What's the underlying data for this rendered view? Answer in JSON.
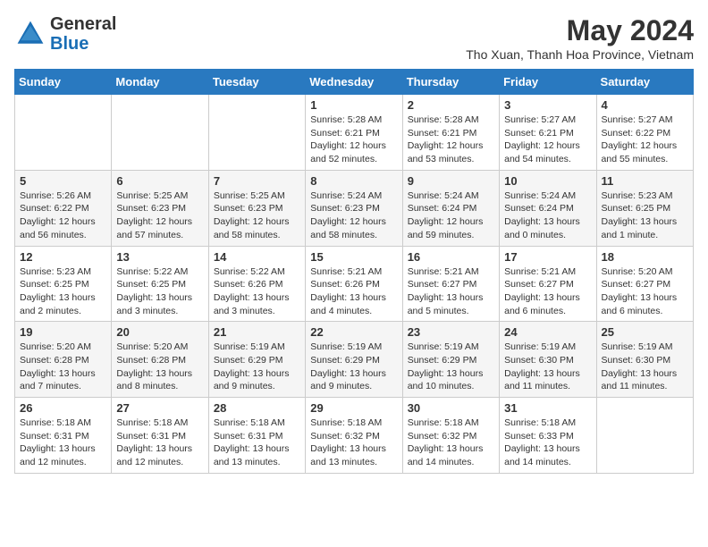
{
  "logo": {
    "general": "General",
    "blue": "Blue"
  },
  "header": {
    "month_year": "May 2024",
    "location": "Tho Xuan, Thanh Hoa Province, Vietnam"
  },
  "days_of_week": [
    "Sunday",
    "Monday",
    "Tuesday",
    "Wednesday",
    "Thursday",
    "Friday",
    "Saturday"
  ],
  "weeks": [
    [
      {
        "day": "",
        "info": ""
      },
      {
        "day": "",
        "info": ""
      },
      {
        "day": "",
        "info": ""
      },
      {
        "day": "1",
        "info": "Sunrise: 5:28 AM\nSunset: 6:21 PM\nDaylight: 12 hours\nand 52 minutes."
      },
      {
        "day": "2",
        "info": "Sunrise: 5:28 AM\nSunset: 6:21 PM\nDaylight: 12 hours\nand 53 minutes."
      },
      {
        "day": "3",
        "info": "Sunrise: 5:27 AM\nSunset: 6:21 PM\nDaylight: 12 hours\nand 54 minutes."
      },
      {
        "day": "4",
        "info": "Sunrise: 5:27 AM\nSunset: 6:22 PM\nDaylight: 12 hours\nand 55 minutes."
      }
    ],
    [
      {
        "day": "5",
        "info": "Sunrise: 5:26 AM\nSunset: 6:22 PM\nDaylight: 12 hours\nand 56 minutes."
      },
      {
        "day": "6",
        "info": "Sunrise: 5:25 AM\nSunset: 6:23 PM\nDaylight: 12 hours\nand 57 minutes."
      },
      {
        "day": "7",
        "info": "Sunrise: 5:25 AM\nSunset: 6:23 PM\nDaylight: 12 hours\nand 58 minutes."
      },
      {
        "day": "8",
        "info": "Sunrise: 5:24 AM\nSunset: 6:23 PM\nDaylight: 12 hours\nand 58 minutes."
      },
      {
        "day": "9",
        "info": "Sunrise: 5:24 AM\nSunset: 6:24 PM\nDaylight: 12 hours\nand 59 minutes."
      },
      {
        "day": "10",
        "info": "Sunrise: 5:24 AM\nSunset: 6:24 PM\nDaylight: 13 hours\nand 0 minutes."
      },
      {
        "day": "11",
        "info": "Sunrise: 5:23 AM\nSunset: 6:25 PM\nDaylight: 13 hours\nand 1 minute."
      }
    ],
    [
      {
        "day": "12",
        "info": "Sunrise: 5:23 AM\nSunset: 6:25 PM\nDaylight: 13 hours\nand 2 minutes."
      },
      {
        "day": "13",
        "info": "Sunrise: 5:22 AM\nSunset: 6:25 PM\nDaylight: 13 hours\nand 3 minutes."
      },
      {
        "day": "14",
        "info": "Sunrise: 5:22 AM\nSunset: 6:26 PM\nDaylight: 13 hours\nand 3 minutes."
      },
      {
        "day": "15",
        "info": "Sunrise: 5:21 AM\nSunset: 6:26 PM\nDaylight: 13 hours\nand 4 minutes."
      },
      {
        "day": "16",
        "info": "Sunrise: 5:21 AM\nSunset: 6:27 PM\nDaylight: 13 hours\nand 5 minutes."
      },
      {
        "day": "17",
        "info": "Sunrise: 5:21 AM\nSunset: 6:27 PM\nDaylight: 13 hours\nand 6 minutes."
      },
      {
        "day": "18",
        "info": "Sunrise: 5:20 AM\nSunset: 6:27 PM\nDaylight: 13 hours\nand 6 minutes."
      }
    ],
    [
      {
        "day": "19",
        "info": "Sunrise: 5:20 AM\nSunset: 6:28 PM\nDaylight: 13 hours\nand 7 minutes."
      },
      {
        "day": "20",
        "info": "Sunrise: 5:20 AM\nSunset: 6:28 PM\nDaylight: 13 hours\nand 8 minutes."
      },
      {
        "day": "21",
        "info": "Sunrise: 5:19 AM\nSunset: 6:29 PM\nDaylight: 13 hours\nand 9 minutes."
      },
      {
        "day": "22",
        "info": "Sunrise: 5:19 AM\nSunset: 6:29 PM\nDaylight: 13 hours\nand 9 minutes."
      },
      {
        "day": "23",
        "info": "Sunrise: 5:19 AM\nSunset: 6:29 PM\nDaylight: 13 hours\nand 10 minutes."
      },
      {
        "day": "24",
        "info": "Sunrise: 5:19 AM\nSunset: 6:30 PM\nDaylight: 13 hours\nand 11 minutes."
      },
      {
        "day": "25",
        "info": "Sunrise: 5:19 AM\nSunset: 6:30 PM\nDaylight: 13 hours\nand 11 minutes."
      }
    ],
    [
      {
        "day": "26",
        "info": "Sunrise: 5:18 AM\nSunset: 6:31 PM\nDaylight: 13 hours\nand 12 minutes."
      },
      {
        "day": "27",
        "info": "Sunrise: 5:18 AM\nSunset: 6:31 PM\nDaylight: 13 hours\nand 12 minutes."
      },
      {
        "day": "28",
        "info": "Sunrise: 5:18 AM\nSunset: 6:31 PM\nDaylight: 13 hours\nand 13 minutes."
      },
      {
        "day": "29",
        "info": "Sunrise: 5:18 AM\nSunset: 6:32 PM\nDaylight: 13 hours\nand 13 minutes."
      },
      {
        "day": "30",
        "info": "Sunrise: 5:18 AM\nSunset: 6:32 PM\nDaylight: 13 hours\nand 14 minutes."
      },
      {
        "day": "31",
        "info": "Sunrise: 5:18 AM\nSunset: 6:33 PM\nDaylight: 13 hours\nand 14 minutes."
      },
      {
        "day": "",
        "info": ""
      }
    ]
  ]
}
